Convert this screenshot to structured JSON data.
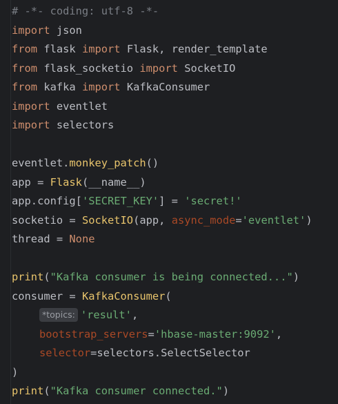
{
  "editor": {
    "colors": {
      "background": "#1e1f22",
      "comment": "#7a7e85",
      "keyword": "#cf8e6d",
      "string": "#6aab73",
      "call": "#e8c46c",
      "param": "#aa4926",
      "builtin": "#8888c6",
      "text": "#bcbec4"
    },
    "lines": [
      [
        {
          "t": "# -*- coding: utf-8 -*-",
          "c": "comment"
        }
      ],
      [
        {
          "t": "import",
          "c": "keyword"
        },
        {
          "t": " json",
          "c": "plain"
        }
      ],
      [
        {
          "t": "from",
          "c": "keyword"
        },
        {
          "t": " flask ",
          "c": "plain"
        },
        {
          "t": "import",
          "c": "keyword"
        },
        {
          "t": " Flask, render_template",
          "c": "plain"
        }
      ],
      [
        {
          "t": "from",
          "c": "keyword"
        },
        {
          "t": " flask_socketio ",
          "c": "plain"
        },
        {
          "t": "import",
          "c": "keyword"
        },
        {
          "t": " SocketIO",
          "c": "plain"
        }
      ],
      [
        {
          "t": "from",
          "c": "keyword"
        },
        {
          "t": " kafka ",
          "c": "plain"
        },
        {
          "t": "import",
          "c": "keyword"
        },
        {
          "t": " KafkaConsumer",
          "c": "plain"
        }
      ],
      [
        {
          "t": "import",
          "c": "keyword"
        },
        {
          "t": " eventlet",
          "c": "plain"
        }
      ],
      [
        {
          "t": "import",
          "c": "keyword"
        },
        {
          "t": " selectors",
          "c": "plain"
        }
      ],
      [],
      [
        {
          "t": "eventlet.",
          "c": "plain"
        },
        {
          "t": "monkey_patch",
          "c": "call"
        },
        {
          "t": "()",
          "c": "plain"
        }
      ],
      [
        {
          "t": "app = ",
          "c": "plain"
        },
        {
          "t": "Flask",
          "c": "call"
        },
        {
          "t": "(__name__)",
          "c": "plain"
        }
      ],
      [
        {
          "t": "app.config[",
          "c": "plain"
        },
        {
          "t": "'SECRET_KEY'",
          "c": "string"
        },
        {
          "t": "] = ",
          "c": "plain"
        },
        {
          "t": "'secret!'",
          "c": "string"
        }
      ],
      [
        {
          "t": "socketio = ",
          "c": "plain"
        },
        {
          "t": "SocketIO",
          "c": "call"
        },
        {
          "t": "(app, ",
          "c": "plain"
        },
        {
          "t": "async_mode",
          "c": "param"
        },
        {
          "t": "=",
          "c": "plain"
        },
        {
          "t": "'eventlet'",
          "c": "string"
        },
        {
          "t": ")",
          "c": "plain"
        }
      ],
      [
        {
          "t": "thread = ",
          "c": "plain"
        },
        {
          "t": "None",
          "c": "keyword"
        }
      ],
      [],
      [
        {
          "t": "print",
          "c": "call"
        },
        {
          "t": "(",
          "c": "plain"
        },
        {
          "t": "\"Kafka consumer is being connected...\"",
          "c": "string"
        },
        {
          "t": ")",
          "c": "plain"
        }
      ],
      [
        {
          "t": "consumer = ",
          "c": "plain"
        },
        {
          "t": "KafkaConsumer",
          "c": "call"
        },
        {
          "t": "(",
          "c": "plain"
        }
      ],
      [
        {
          "t": "*topics:",
          "c": "hint"
        },
        {
          "t": "'result'",
          "c": "string"
        },
        {
          "t": ",",
          "c": "plain"
        }
      ],
      [
        {
          "t": "bootstrap_servers",
          "c": "param"
        },
        {
          "t": "=",
          "c": "plain"
        },
        {
          "t": "'hbase-master:9092'",
          "c": "string"
        },
        {
          "t": ",",
          "c": "plain"
        }
      ],
      [
        {
          "t": "selector",
          "c": "param"
        },
        {
          "t": "=selectors.SelectSelector",
          "c": "plain"
        }
      ],
      [
        {
          "t": ")",
          "c": "plain"
        }
      ],
      [
        {
          "t": "print",
          "c": "call"
        },
        {
          "t": "(",
          "c": "plain"
        },
        {
          "t": "\"Kafka consumer connected.\"",
          "c": "string"
        },
        {
          "t": ")",
          "c": "plain"
        }
      ]
    ],
    "indented_lines": [
      16,
      17,
      18
    ]
  }
}
